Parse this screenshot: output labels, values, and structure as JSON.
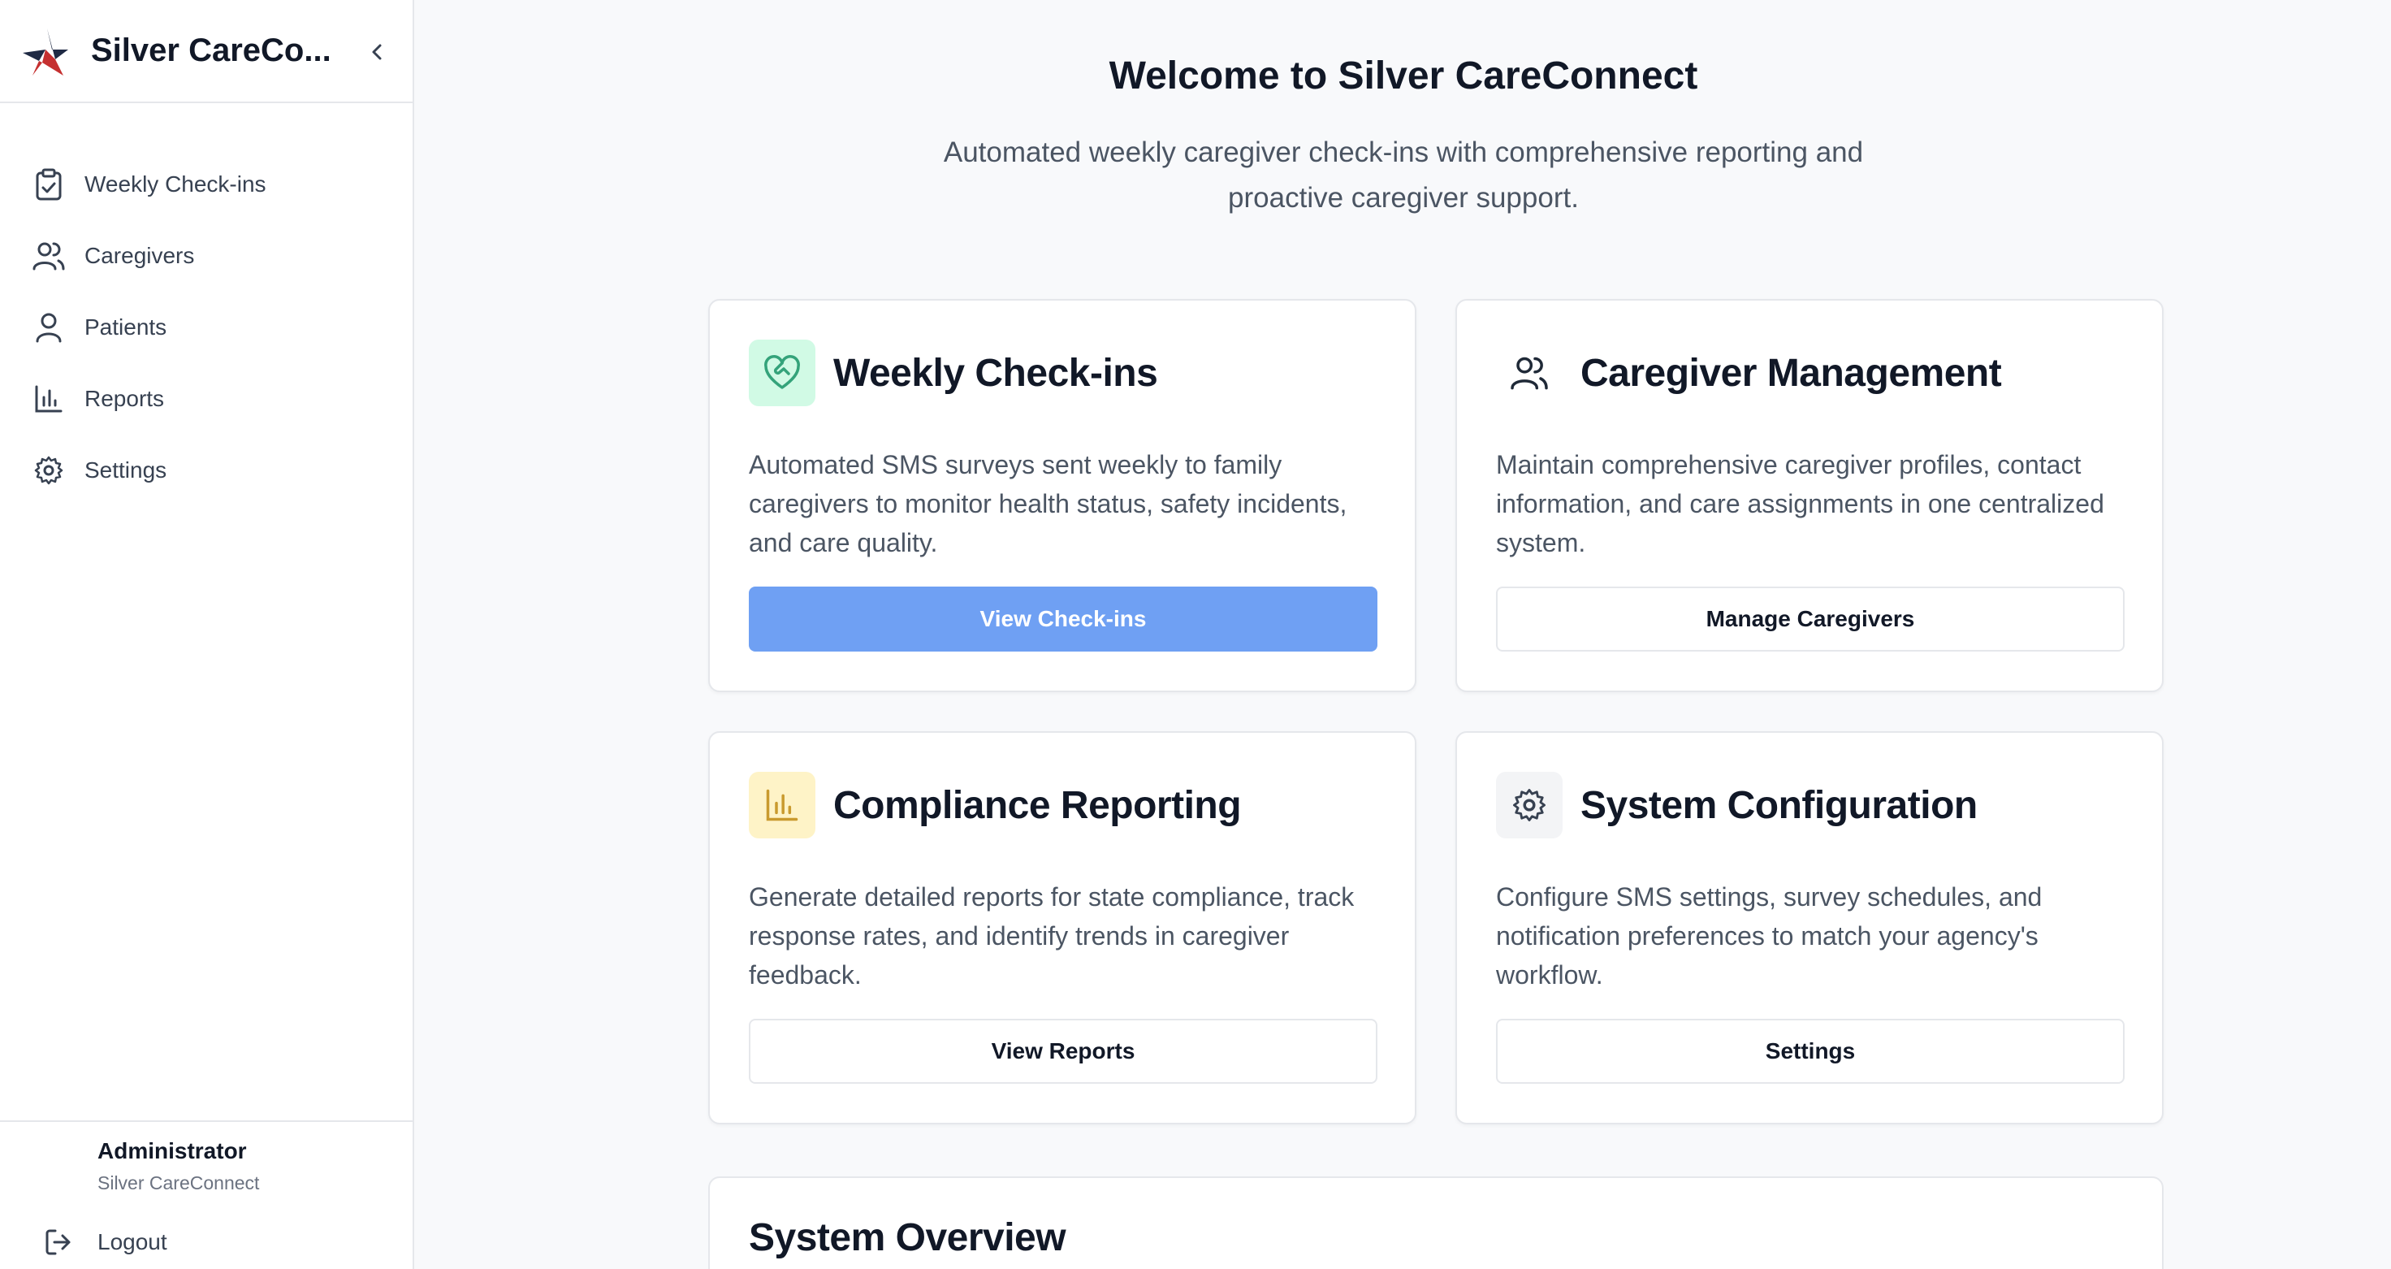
{
  "sidebar": {
    "app_title": "Silver CareCo...",
    "items": [
      {
        "label": "Weekly Check-ins",
        "icon": "clipboard-check-icon"
      },
      {
        "label": "Caregivers",
        "icon": "users-icon"
      },
      {
        "label": "Patients",
        "icon": "user-icon"
      },
      {
        "label": "Reports",
        "icon": "bar-chart-icon"
      },
      {
        "label": "Settings",
        "icon": "gear-icon"
      }
    ],
    "user": {
      "name": "Administrator",
      "org": "Silver CareConnect"
    },
    "logout_label": "Logout"
  },
  "main": {
    "title": "Welcome to Silver CareConnect",
    "subtitle": "Automated weekly caregiver check-ins with comprehensive reporting and proactive caregiver support.",
    "cards": [
      {
        "title": "Weekly Check-ins",
        "description": "Automated SMS surveys sent weekly to family caregivers to monitor health status, safety incidents, and care quality.",
        "button": "View Check-ins",
        "icon": "heart-handshake-icon"
      },
      {
        "title": "Caregiver Management",
        "description": "Maintain comprehensive caregiver profiles, contact information, and care assignments in one centralized system.",
        "button": "Manage Caregivers",
        "icon": "users-icon"
      },
      {
        "title": "Compliance Reporting",
        "description": "Generate detailed reports for state compliance, track response rates, and identify trends in caregiver feedback.",
        "button": "View Reports",
        "icon": "bar-chart-icon"
      },
      {
        "title": "System Configuration",
        "description": "Configure SMS settings, survey schedules, and notification preferences to match your agency's workflow.",
        "button": "Settings",
        "icon": "gear-icon"
      }
    ],
    "overview_title": "System Overview"
  },
  "colors": {
    "primary_button": "#6fa0f3",
    "checkins_icon_bg": "#d1fae5",
    "reports_icon_bg": "#fef3c7",
    "settings_icon_bg": "#f3f4f6"
  }
}
